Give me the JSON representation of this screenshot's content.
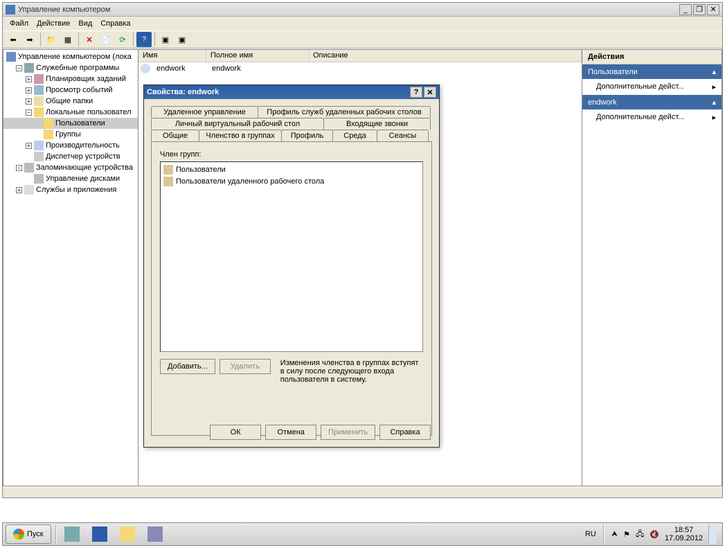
{
  "window": {
    "title": "Управление компьютером"
  },
  "menu": {
    "file": "Файл",
    "action": "Действие",
    "view": "Вид",
    "help": "Справка"
  },
  "tree": {
    "root": "Управление компьютером (лока",
    "sys_tools": "Служебные программы",
    "task_sched": "Планировщик заданий",
    "event_viewer": "Просмотр событий",
    "shared_folders": "Общие папки",
    "local_users": "Локальные пользовател",
    "users": "Пользователи",
    "groups": "Группы",
    "performance": "Производительность",
    "device_mgr": "Диспетчер устройств",
    "storage": "Запоминающие устройства",
    "disk_mgmt": "Управление дисками",
    "services": "Службы и приложения"
  },
  "list": {
    "col_name": "Имя",
    "col_fullname": "Полное имя",
    "col_desc": "Описание",
    "row_name": "endwork",
    "row_full": "endwork"
  },
  "actions": {
    "header": "Действия",
    "section1": "Пользователи",
    "more1": "Дополнительные дейст...",
    "section2": "endwork",
    "more2": "Дополнительные дейст..."
  },
  "dialog": {
    "title": "Свойства: endwork",
    "tabs": {
      "remote_ctrl": "Удаленное управление",
      "rds_profile": "Профиль служб удаленных рабочих столов",
      "personal_vd": "Личный виртуальный рабочий стол",
      "incoming_calls": "Входящие звонки",
      "general": "Общие",
      "member_of": "Членство в группах",
      "profile": "Профиль",
      "env": "Среда",
      "sessions": "Сеансы"
    },
    "member_of_label": "Член групп:",
    "groups": {
      "g1": "Пользователи",
      "g2": "Пользователи удаленного рабочего стола"
    },
    "add": "Добавить...",
    "remove": "Удалить",
    "note": "Изменения членства в группах вступят в силу после следующего входа пользователя в систему.",
    "ok": "ОК",
    "cancel": "Отмена",
    "apply": "Применить",
    "help": "Справка"
  },
  "taskbar": {
    "start": "Пуск",
    "lang": "RU",
    "time": "18:57",
    "date": "17.09.2012"
  }
}
